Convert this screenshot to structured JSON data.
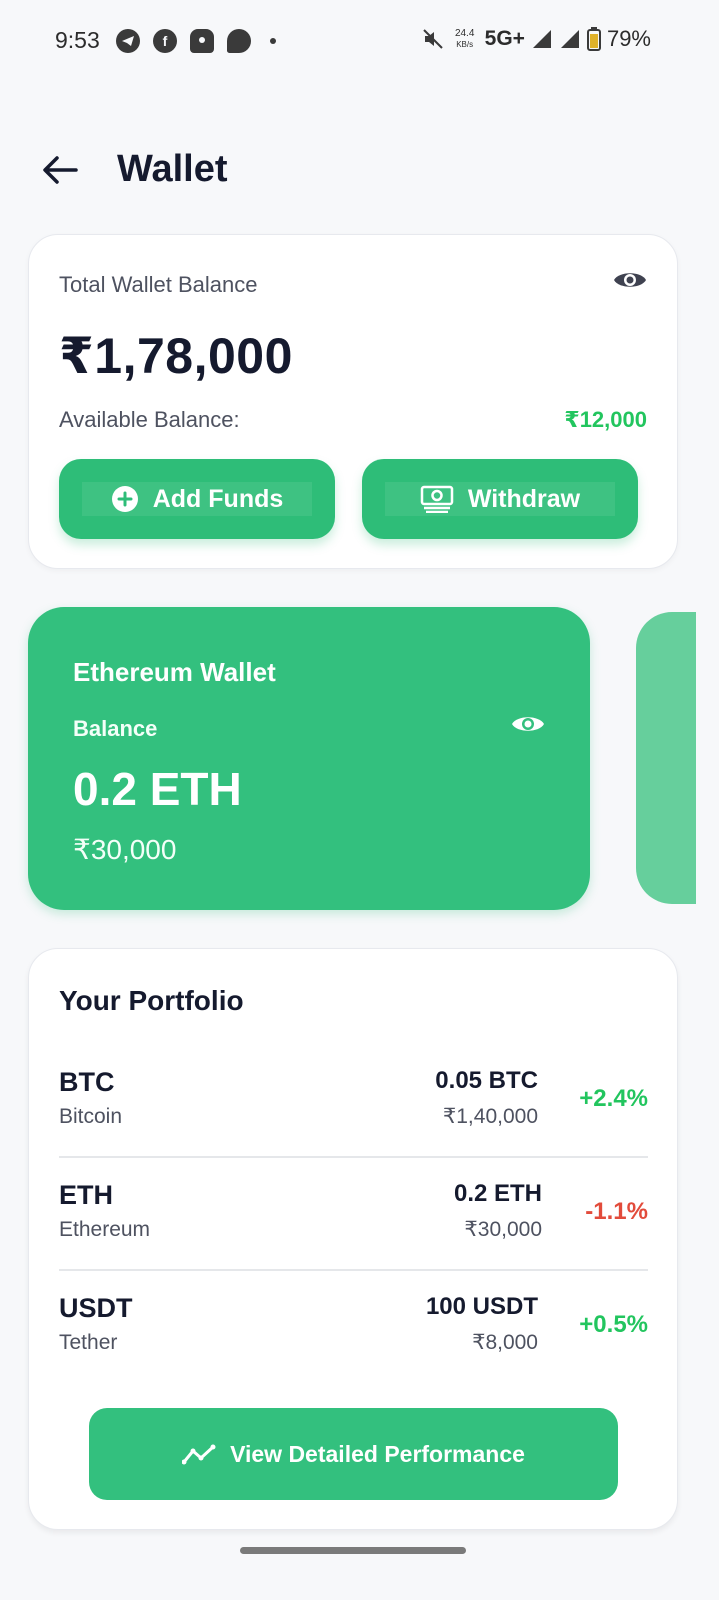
{
  "status_bar": {
    "time": "9:53",
    "speed_value": "24.4",
    "speed_unit": "KB/s",
    "network": "5G+",
    "battery": "79%",
    "icons_left": [
      "telegram-icon",
      "facebook-icon",
      "snapchat-icon",
      "chat-icon"
    ]
  },
  "header": {
    "title": "Wallet"
  },
  "balance_card": {
    "label": "Total Wallet Balance",
    "amount": "₹1,78,000",
    "available_label": "Available Balance:",
    "available_value": "₹12,000",
    "add_funds_label": "Add Funds",
    "withdraw_label": "Withdraw"
  },
  "crypto_wallet": {
    "title": "Ethereum Wallet",
    "balance_label": "Balance",
    "amount": "0.2 ETH",
    "fiat": "₹30,000"
  },
  "portfolio": {
    "title": "Your Portfolio",
    "items": [
      {
        "symbol": "BTC",
        "name": "Bitcoin",
        "amount": "0.05 BTC",
        "fiat": "₹1,40,000",
        "change": "+2.4%"
      },
      {
        "symbol": "ETH",
        "name": "Ethereum",
        "amount": "0.2 ETH",
        "fiat": "₹30,000",
        "change": "-1.1%"
      },
      {
        "symbol": "USDT",
        "name": "Tether",
        "amount": "100 USDT",
        "fiat": "₹8,000",
        "change": "+0.5%"
      }
    ],
    "button_label": "View Detailed Performance"
  },
  "colors": {
    "accent": "#33c07e",
    "positive": "#22c55e",
    "negative": "#e24b3b",
    "text_dark": "#151a2e"
  }
}
